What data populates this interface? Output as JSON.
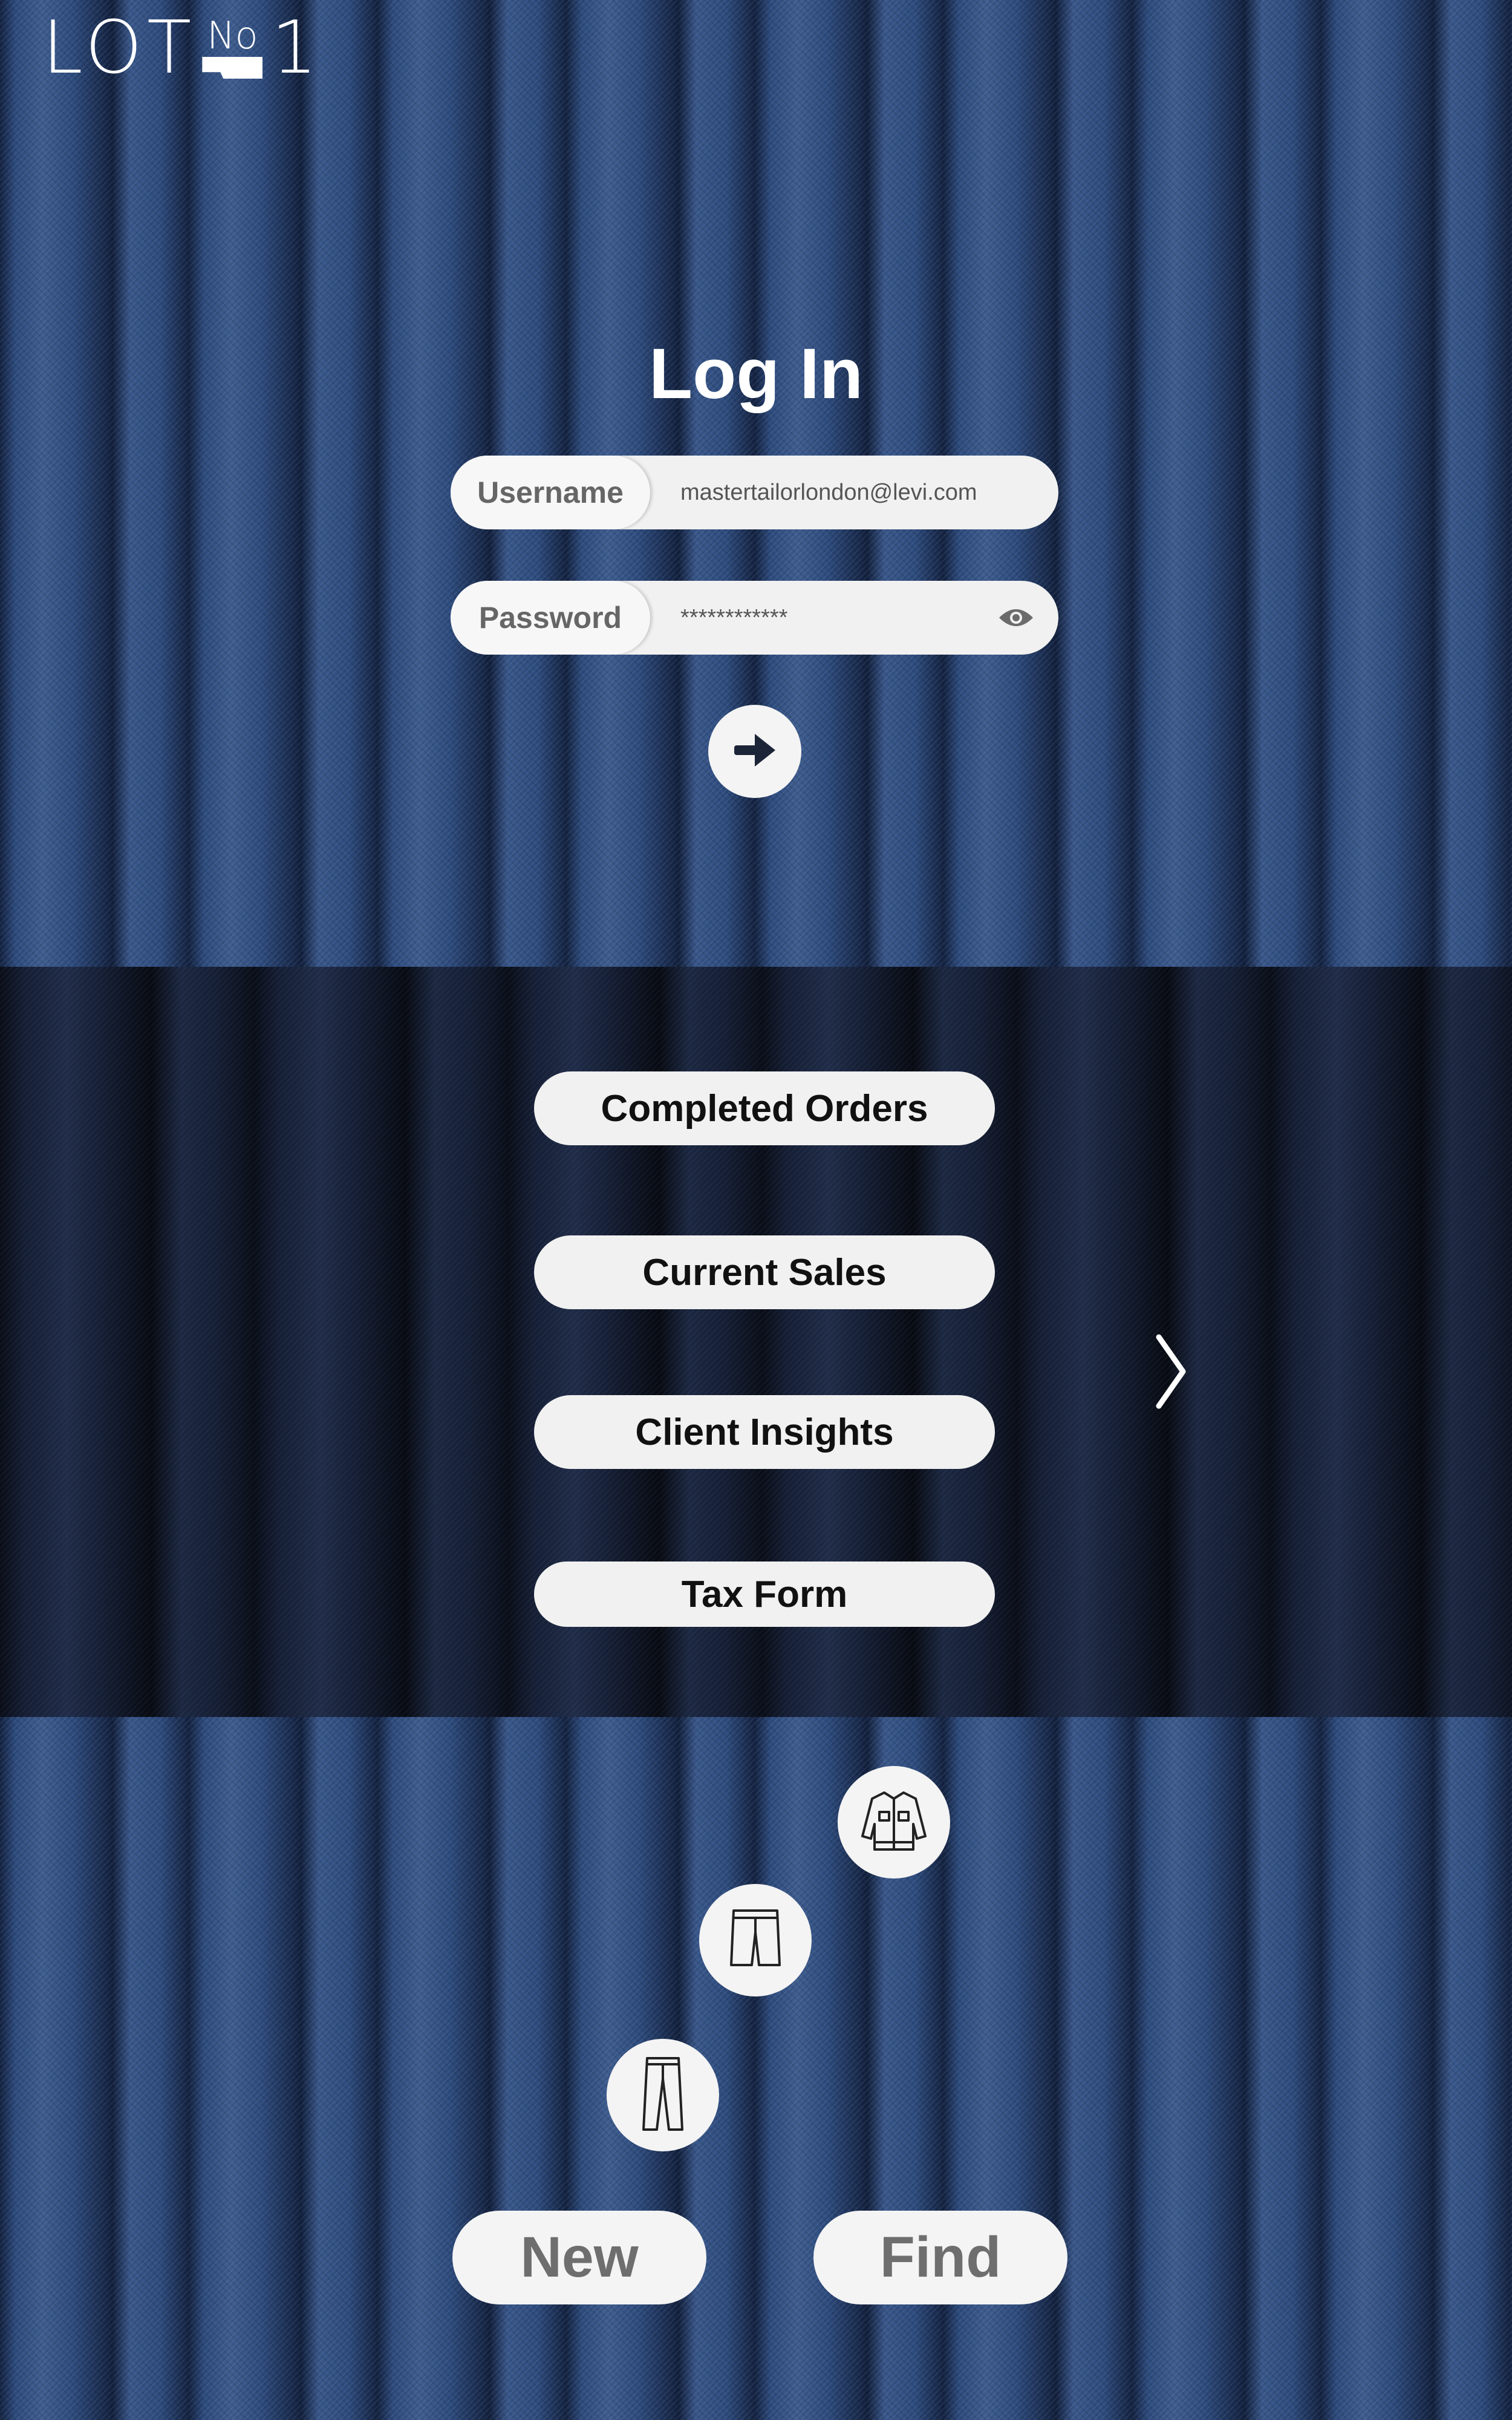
{
  "brand": {
    "logo_text_lot": "LOT",
    "logo_text_no": "No",
    "logo_text_one": "1"
  },
  "login": {
    "title": "Log In",
    "username_label": "Username",
    "username_value": "mastertailorlondon@levi.com",
    "password_label": "Password",
    "password_value": "************",
    "submit_icon": "arrow-right-icon",
    "reveal_icon": "eye-icon"
  },
  "menu": {
    "items": [
      {
        "label": "Completed Orders"
      },
      {
        "label": "Current Sales"
      },
      {
        "label": "Client Insights"
      },
      {
        "label": "Tax Form"
      }
    ],
    "next_icon": "chevron-right-icon"
  },
  "garments": {
    "icons": [
      "jacket-icon",
      "shorts-icon",
      "jeans-icon"
    ]
  },
  "actions": {
    "new_label": "New",
    "find_label": "Find"
  },
  "colors": {
    "denim": "#2c4a7c",
    "denim_dark": "#141d33",
    "pill_bg": "#f1f1f1",
    "label_text": "#666666",
    "arrow": "#1c2438"
  }
}
